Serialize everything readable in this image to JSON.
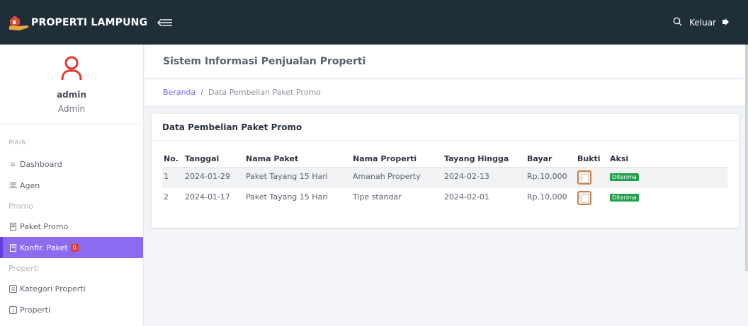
{
  "app": {
    "brand": "PROPERTI LAMPUNG",
    "logout_label": "Keluar"
  },
  "icons": {
    "logo": "house-hand-icon",
    "menu_toggle": "menu-toggle-icon",
    "search": "search-icon",
    "logout": "logout-icon",
    "avatar": "user-avatar-icon"
  },
  "colors": {
    "topbar": "#1f2f3a",
    "accent": "#8b6cf0",
    "success": "#1fa04a",
    "danger": "#e53935"
  },
  "sidebar": {
    "username": "admin",
    "role": "Admin",
    "main_heading": "MAIN",
    "items": [
      {
        "label": "Dashboard",
        "icon": "home-icon"
      },
      {
        "label": "Agen",
        "icon": "users-icon"
      }
    ],
    "promo_heading": "Promo",
    "promo_items": [
      {
        "label": "Paket Promo",
        "icon": "doc-icon"
      },
      {
        "label": "Konfir. Paket",
        "icon": "doc-icon",
        "badge": "0",
        "active": true
      }
    ],
    "properti_heading": "Properti",
    "properti_items": [
      {
        "label": "Kategori Properti",
        "icon": "list-icon"
      },
      {
        "label": "Properti",
        "icon": "info-icon"
      }
    ]
  },
  "header": {
    "title": "Sistem Informasi Penjualan Properti"
  },
  "breadcrumb": {
    "home": "Beranda",
    "separator": "/",
    "current": "Data Pembelian Paket Promo"
  },
  "card": {
    "title": "Data Pembelian Paket Promo"
  },
  "table": {
    "columns": [
      "No.",
      "Tanggal",
      "Nama Paket",
      "Nama Properti",
      "Tayang Hingga",
      "Bayar",
      "Bukti",
      "Aksi"
    ],
    "rows": [
      {
        "no": "1",
        "tanggal": "2024-01-29",
        "paket": "Paket Tayang 15 Hari",
        "properti": "Amanah Property",
        "tayang": "2024-02-13",
        "bayar": "Rp.10,000",
        "aksi": "Diterima"
      },
      {
        "no": "2",
        "tanggal": "2024-01-17",
        "paket": "Paket Tayang 15 Hari",
        "properti": "Tipe standar",
        "tayang": "2024-02-01",
        "bayar": "Rp.10,000",
        "aksi": "Diterima"
      }
    ]
  }
}
